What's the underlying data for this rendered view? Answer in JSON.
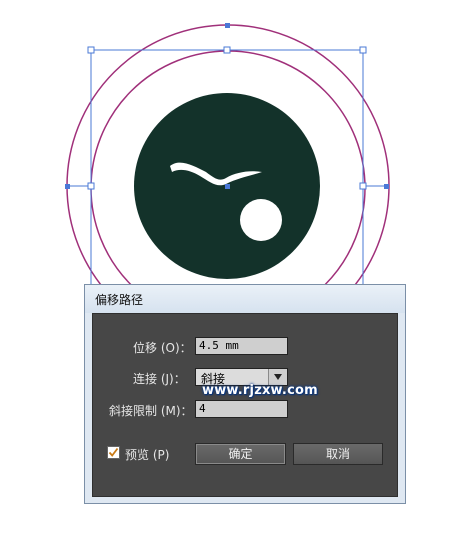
{
  "dialog": {
    "title": "偏移路径",
    "offset_label": "位移 (O)：",
    "offset_value": "4.5 mm",
    "join_label": "连接 (J)：",
    "join_value": "斜接",
    "miter_label": "斜接限制 (M)：",
    "miter_value": "4",
    "preview_label": "预览 (P)",
    "preview_checked": true,
    "ok_label": "确定",
    "cancel_label": "取消"
  },
  "watermark": "www.rjzxw.com",
  "colors": {
    "artwork_fill": "#13322a",
    "outer_path": "#a0307a",
    "selection": "#4a78d6",
    "dialog_body": "#474747"
  }
}
